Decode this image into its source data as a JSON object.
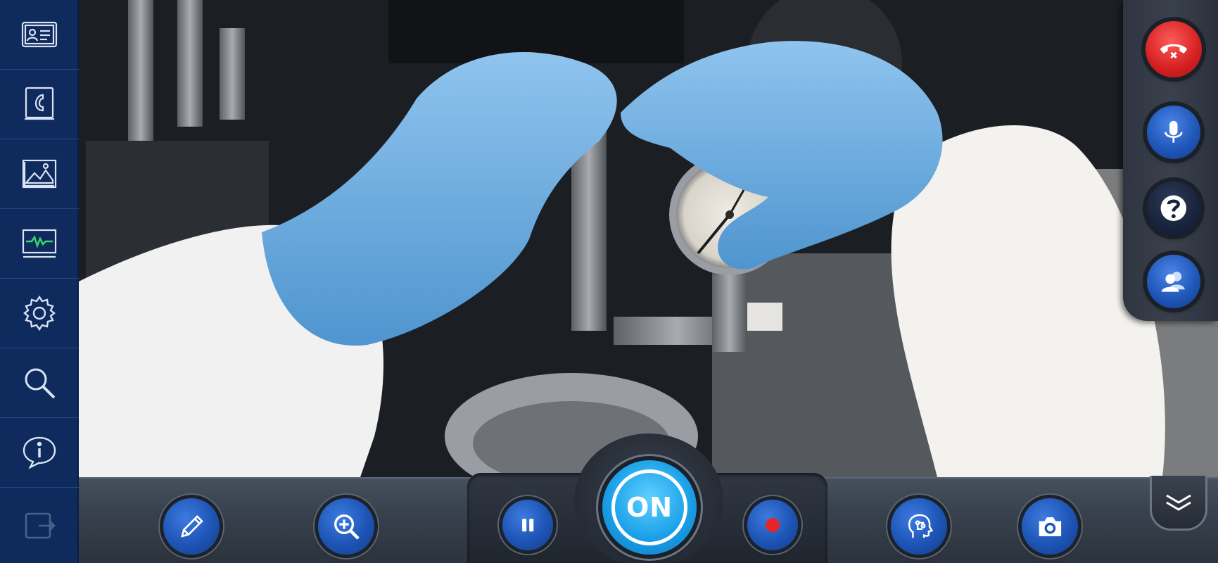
{
  "sidebar": {
    "items": [
      {
        "icon": "contact-card-icon"
      },
      {
        "icon": "phonebook-icon"
      },
      {
        "icon": "gallery-icon"
      },
      {
        "icon": "monitor-icon"
      },
      {
        "icon": "gear-icon"
      },
      {
        "icon": "search-icon"
      },
      {
        "icon": "info-icon"
      },
      {
        "icon": "logout-icon"
      }
    ]
  },
  "call_panel": {
    "buttons": [
      {
        "icon": "hang-up-icon",
        "color": "#e02a2a"
      },
      {
        "icon": "microphone-icon",
        "color": "#1d54b5"
      },
      {
        "icon": "help-icon",
        "color": "#1a2740"
      },
      {
        "icon": "add-participant-icon",
        "color": "#1d54b5"
      }
    ]
  },
  "toolbar": {
    "on_label": "ON",
    "buttons": [
      {
        "icon": "pencil-icon"
      },
      {
        "icon": "zoom-in-icon"
      },
      {
        "icon": "pause-icon"
      },
      {
        "icon": "record-icon"
      },
      {
        "icon": "ai-head-icon"
      },
      {
        "icon": "camera-icon"
      },
      {
        "icon": "chevron-double-down-icon"
      }
    ]
  },
  "colors": {
    "sidebar_bg": "#0f2a5c",
    "accent_blue": "#1d54b5",
    "on_button": "#1aa0e8",
    "hang_up": "#e02a2a"
  }
}
